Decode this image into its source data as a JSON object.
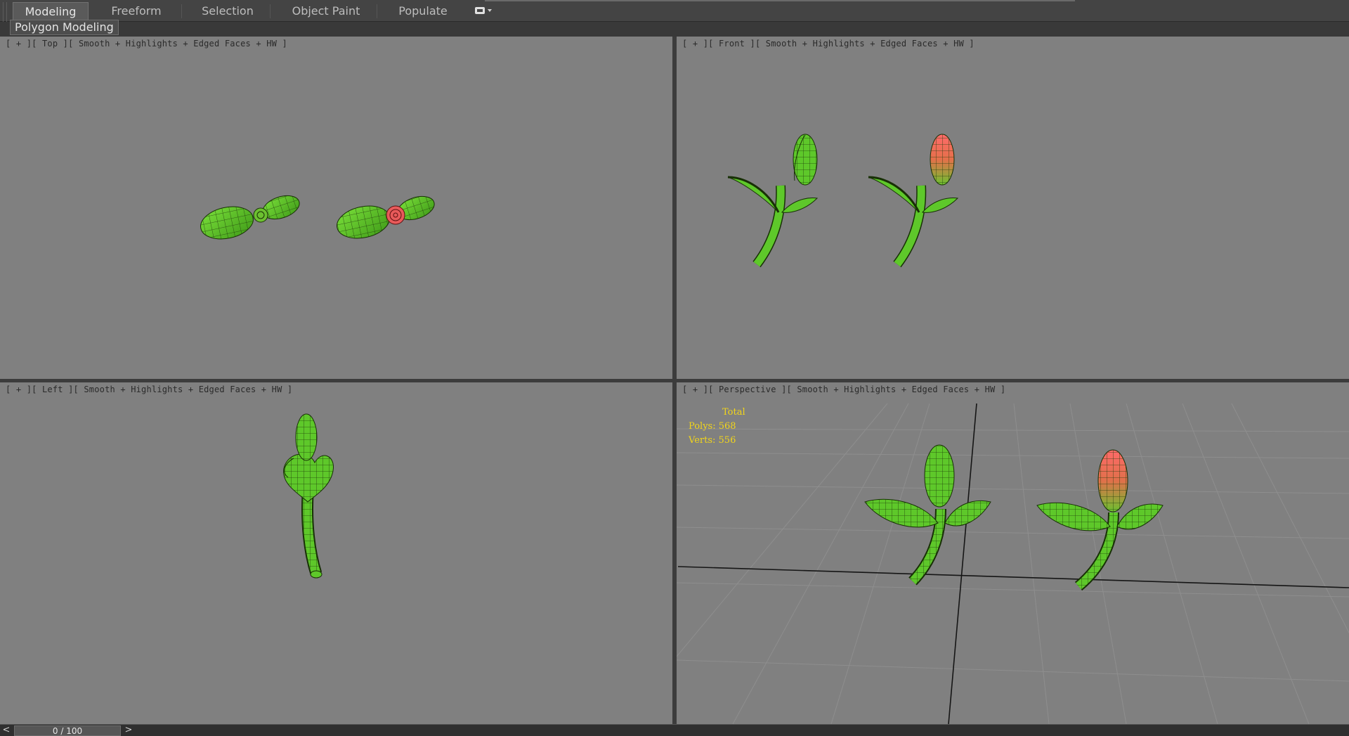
{
  "ribbon": {
    "tabs": [
      {
        "label": "Modeling",
        "active": true
      },
      {
        "label": "Freeform",
        "active": false
      },
      {
        "label": "Selection",
        "active": false
      },
      {
        "label": "Object Paint",
        "active": false
      },
      {
        "label": "Populate",
        "active": false
      }
    ],
    "panel_button": "Polygon Modeling",
    "options_icon": "ribbon-display-options-icon"
  },
  "viewports": {
    "top": {
      "label": "[ + ][ Top ][ Smooth + Highlights + Edged Faces + HW ]"
    },
    "front": {
      "label": "[ + ][ Front ][ Smooth + Highlights + Edged Faces + HW ]"
    },
    "left": {
      "label": "[ + ][ Left ][ Smooth + Highlights + Edged Faces + HW ]"
    },
    "perspective": {
      "label": "[ + ][ Perspective ][ Smooth + Highlights + Edged Faces + HW ]"
    }
  },
  "stats": {
    "title": "Total",
    "polys_label": "Polys:",
    "polys_value": "568",
    "verts_label": "Verts:",
    "verts_value": "556"
  },
  "timeline": {
    "frame_display": "0 / 100",
    "prev_label": "<",
    "next_label": ">"
  },
  "colors": {
    "viewport_bg": "#808080",
    "leaf_green": "#5ec82a",
    "bud_red": "#e85a5a",
    "stats_yellow": "#f2d51a",
    "ui_dark": "#2b2b2b"
  }
}
